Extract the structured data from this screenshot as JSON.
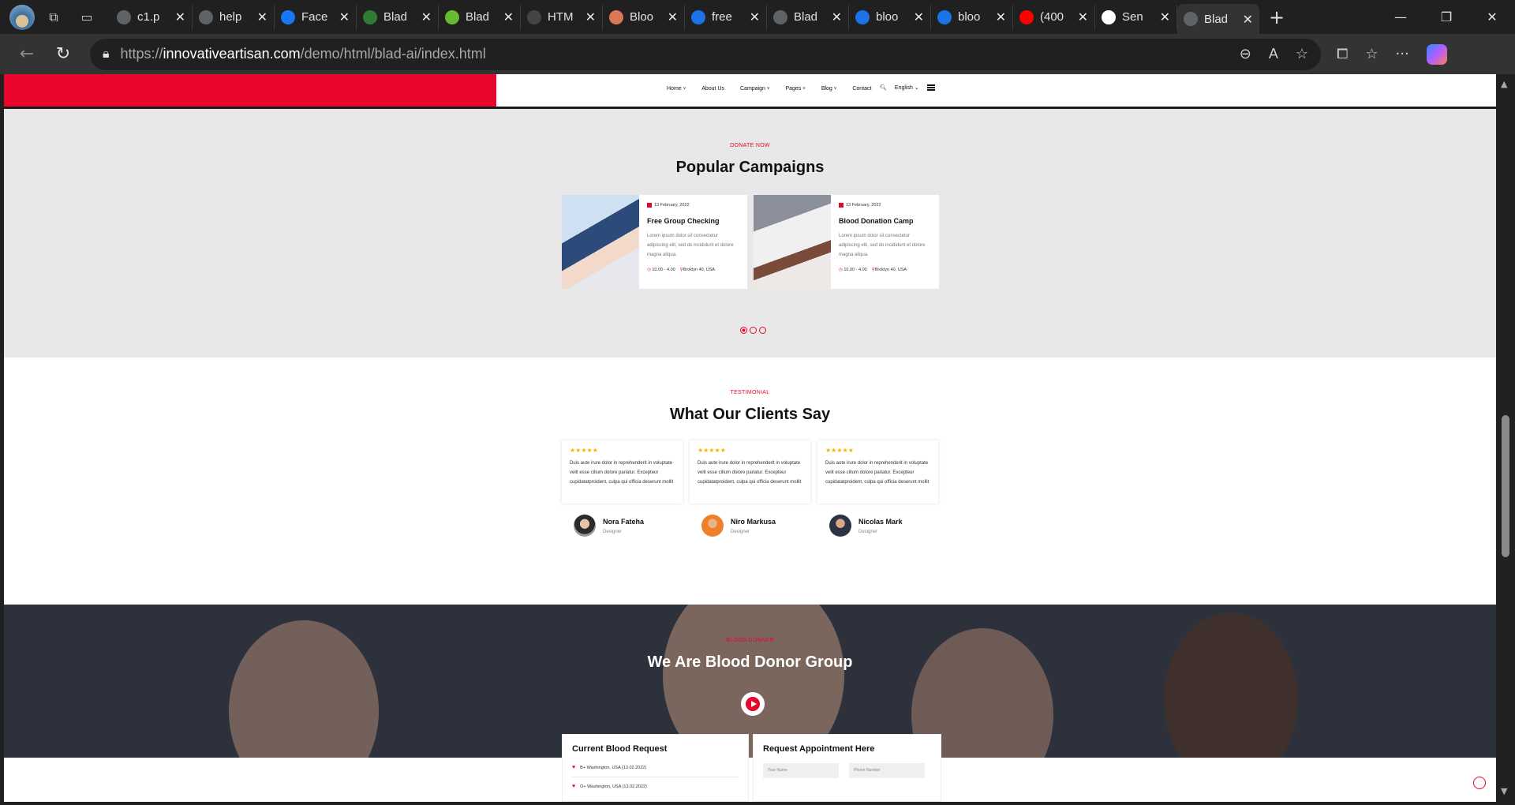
{
  "browser": {
    "tabs": [
      {
        "label": "c1.p",
        "icon": "globe-icon",
        "color": "#5f6368"
      },
      {
        "label": "help",
        "icon": "globe-icon",
        "color": "#5f6368"
      },
      {
        "label": "Face",
        "icon": "facebook-icon",
        "color": "#1877f2"
      },
      {
        "label": "Blad",
        "icon": "blad-icon",
        "color": "#2e7d32"
      },
      {
        "label": "Blad",
        "icon": "blad-icon",
        "color": "#66bb33"
      },
      {
        "label": "HTM",
        "icon": "openai-icon",
        "color": "#444444"
      },
      {
        "label": "Bloo",
        "icon": "claude-icon",
        "color": "#d97757"
      },
      {
        "label": "free",
        "icon": "search-icon",
        "color": "#1a73e8"
      },
      {
        "label": "Blad",
        "icon": "globe-icon",
        "color": "#5f6368"
      },
      {
        "label": "bloo",
        "icon": "search-icon",
        "color": "#1a73e8"
      },
      {
        "label": "bloo",
        "icon": "search-icon",
        "color": "#1a73e8"
      },
      {
        "label": "(400",
        "icon": "youtube-icon",
        "color": "#ff0000"
      },
      {
        "label": "Sen",
        "icon": "github-icon",
        "color": "#ffffff"
      },
      {
        "label": "Blad",
        "icon": "globe-icon",
        "color": "#5f6368",
        "active": true
      }
    ],
    "url_prefix": "https://",
    "url_host": "innovativeartisan.com",
    "url_path": "/demo/html/blad-ai/index.html"
  },
  "site": {
    "brand_color": "#e8062b",
    "menu": [
      "Home",
      "About Us",
      "Campaign",
      "Pages",
      "Blog",
      "Contact"
    ],
    "language": "English"
  },
  "campaigns": {
    "kicker": "DONATE NOW",
    "title": "Popular Campaigns",
    "cards": [
      {
        "date": "13 February, 2022",
        "title": "Free Group Checking",
        "text": "Lorem ipsum dolor sit consectetur adipiscing elit, sed do incididunt et dolore magna aliqua.",
        "time": "10.00 - 4.00",
        "place": "Broklyn 40, USA"
      },
      {
        "date": "13 February, 2022",
        "title": "Blood Donation Camp",
        "text": "Lorem ipsum dolor sit consectetur adipiscing elit, sed do incididunt et dolore magna aliqua.",
        "time": "10.00 - 4.00",
        "place": "Broklyn 40, USA"
      }
    ]
  },
  "testimonials": {
    "kicker": "TESTIMONIAL",
    "title": "What Our Clients Say",
    "stars": "★★★★★",
    "items": [
      {
        "text": "Duis aute irure dolor in reprehenderit in voluptate velit esse cillum dolore pariatur. Excepteur cupidatatproident, culpa qui officia deserunt mollit",
        "name": "Nora Fateha",
        "role": "Designer"
      },
      {
        "text": "Duis aute irure dolor in reprehenderit in voluptate velit esse cillum dolore pariatur. Excepteur cupidatatproident, culpa qui officia deserunt mollit",
        "name": "Niro Markusa",
        "role": "Designer"
      },
      {
        "text": "Duis aute irure dolor in reprehenderit in voluptate velit esse cillum dolore pariatur. Excepteur cupidatatproident, culpa qui officia deserunt mollit",
        "name": "Nicolas Mark",
        "role": "Designer"
      }
    ]
  },
  "donor": {
    "kicker": "BLOOD DONNER",
    "title": "We Are Blood Donor Group",
    "requests_title": "Current Blood Request",
    "requests": [
      "B+ Washington, USA (13.02.2022)",
      "O+ Washington, USA (13.02.2022)"
    ],
    "appointment_title": "Request Appointment Here",
    "name_placeholder": "Your Name",
    "phone_placeholder": "Phone Number"
  }
}
